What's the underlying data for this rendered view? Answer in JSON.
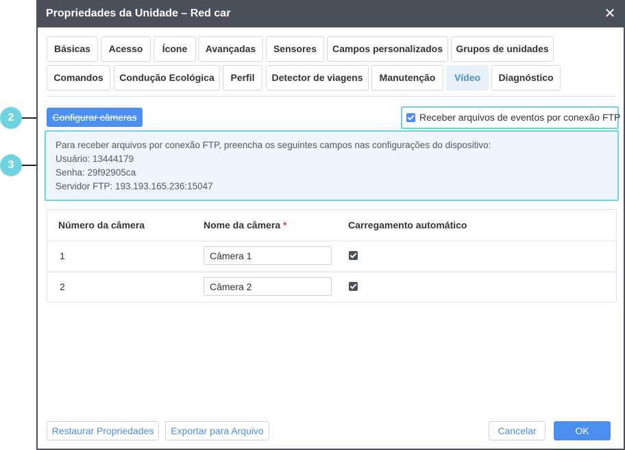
{
  "dialog": {
    "title": "Propriedades da Unidade – Red car",
    "close_glyph": "✕"
  },
  "tabs": {
    "row1": [
      "Básicas",
      "Acesso",
      "Ícone",
      "Avançadas",
      "Sensores",
      "Campos personalizados",
      "Grupos de unidades"
    ],
    "row2": [
      "Comandos",
      "Condução Ecológica",
      "Perfil",
      "Detector de viagens",
      "Manutenção",
      "Vídeo",
      "Diagnóstico"
    ],
    "active": "Vídeo"
  },
  "video": {
    "configure_cameras": "Configurar câmeras",
    "ftp_checkbox_label": "Receber arquivos de eventos por conexão FTP",
    "ftp_checked": true,
    "info": {
      "intro": "Para receber arquivos por conexão FTP, preencha os seguintes campos nas configurações do dispositivo:",
      "user": "Usuário: 13444179",
      "password": "Senha: 29f92905ca",
      "server": "Servidor FTP: 193.193.165.236:15047"
    }
  },
  "cameras_table": {
    "headers": {
      "number": "Número da câmera",
      "name": "Nome da câmera",
      "required_mark": "*",
      "autoload": "Carregamento automático"
    },
    "rows": [
      {
        "number": "1",
        "name": "Câmera 1",
        "autoload": true
      },
      {
        "number": "2",
        "name": "Câmera 2",
        "autoload": true
      }
    ]
  },
  "footer": {
    "restore": "Restaurar Propriedades",
    "export": "Exportar para Arquivo",
    "cancel": "Cancelar",
    "ok": "OK"
  },
  "callouts": [
    "2",
    "3"
  ],
  "colors": {
    "titlebar": "#4a4f59",
    "accent": "#4a8ef0",
    "highlight": "#6fd3e0",
    "info_bg": "#eef5fb",
    "required": "#e0463b"
  }
}
